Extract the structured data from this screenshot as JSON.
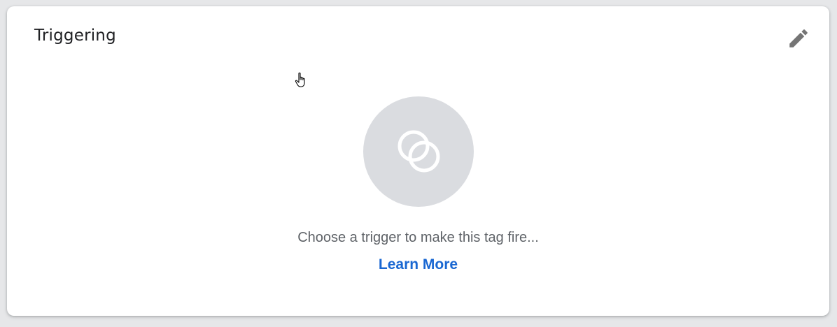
{
  "card": {
    "title": "Triggering",
    "edit_icon": "pencil-edit-icon"
  },
  "empty_state": {
    "illustration_icon": "trigger-circles-icon",
    "message": "Choose a trigger to make this tag fire...",
    "learn_more_label": "Learn More"
  },
  "colors": {
    "background": "#e6e7e9",
    "card": "#ffffff",
    "illustration_bg": "#dadce0",
    "icon_gray": "#757575",
    "message_text": "#5f6368",
    "link": "#1967d2"
  },
  "mouse_cursor": "hand-pointer-cursor-icon"
}
